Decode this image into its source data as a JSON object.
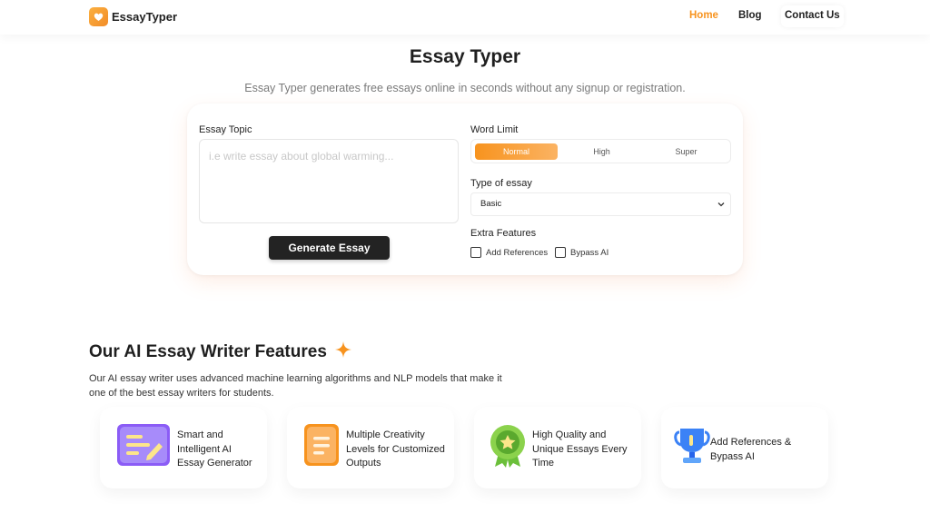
{
  "nav": {
    "logo_text": "EssayTyper",
    "links": {
      "home": "Home",
      "blog": "Blog",
      "contact": "Contact Us"
    },
    "active_color": "#f7931e"
  },
  "hero": {
    "title": "Essay Typer",
    "subtitle": "Essay Typer generates free essays online in seconds without any signup or registration."
  },
  "form": {
    "topic_label": "Essay Topic",
    "topic_placeholder": "i.e write essay about global warming...",
    "topic_value": "",
    "generate_label": "Generate Essay",
    "word_limit_label": "Word Limit",
    "word_limit_options": [
      "Normal",
      "High",
      "Super"
    ],
    "word_limit_selected": "Normal",
    "type_label": "Type of essay",
    "type_value": "Basic",
    "extra_label": "Extra Features",
    "extras": {
      "references": "Add References",
      "bypass": "Bypass AI"
    },
    "accent_gradient": [
      "#f7931e",
      "#fbb363"
    ]
  },
  "features": {
    "title": "Our AI Essay Writer Features",
    "description": "Our AI essay writer uses advanced machine learning algorithms and NLP models that make it one of the best essay writers for students.",
    "cards": [
      {
        "icon": "document-pen-icon",
        "text": "Smart and Intelligent AI Essay Generator"
      },
      {
        "icon": "notes-icon",
        "text": "Multiple Creativity Levels for Customized Outputs"
      },
      {
        "icon": "quality-badge-icon",
        "text": "High Quality and Unique Essays Every Time"
      },
      {
        "icon": "trophy-icon",
        "text": "Add References & Bypass AI"
      }
    ]
  }
}
